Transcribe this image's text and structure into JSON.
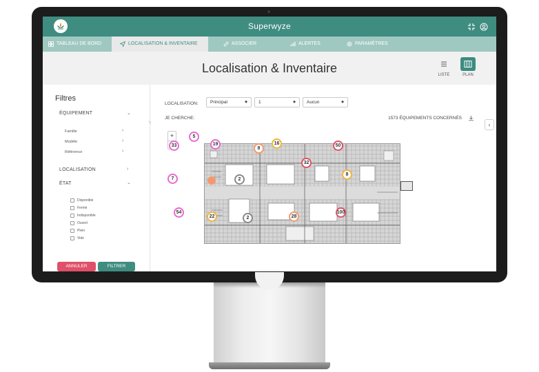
{
  "app": {
    "title": "Superwyze",
    "brand_color": "#3f8c80",
    "nav_color": "#9fc8c1"
  },
  "nav": [
    {
      "label": "TABLEAU DE BORD",
      "icon": "dashboard-grid-icon",
      "active": false
    },
    {
      "label": "LOCALISATION & INVENTAIRE",
      "icon": "location-arrow-icon",
      "active": true
    },
    {
      "label": "ASSOCIER",
      "icon": "link-icon",
      "active": false
    },
    {
      "label": "ALERTES",
      "icon": "signal-bars-icon",
      "active": false
    },
    {
      "label": "PARAMÈTRES",
      "icon": "gear-icon",
      "active": false
    }
  ],
  "page": {
    "title": "Localisation & Inventaire",
    "view_list_label": "LISTE",
    "view_plan_label": "PLAN",
    "active_view": "plan"
  },
  "filters": {
    "title": "Filtres",
    "equipment_label": "ÉQUIPEMENT",
    "equipment_items": [
      "Famille",
      "Modèle",
      "Référence"
    ],
    "location_label": "LOCALISATION",
    "state_label": "ÉTAT",
    "state_options": [
      "Disponible",
      "Fermé",
      "Indisponible",
      "Ouvert",
      "Plein",
      "Vide"
    ],
    "cancel_label": "ANNULER",
    "filter_label": "FILTRER",
    "cancel_color": "#e05068"
  },
  "toolbar": {
    "location_label": "LOCALISATION:",
    "select_site": "Principal",
    "select_floor": "1",
    "select_zone": "Aucun",
    "search_label": "JE CHERCHE:",
    "count_text": "1573 ÉQUIPEMENTS CONCERNÉS"
  },
  "zoom": {
    "in": "+",
    "out": "−"
  },
  "markers": [
    {
      "value": "5",
      "color": "#e86ad0"
    },
    {
      "value": "33",
      "color": "#e86ad0"
    },
    {
      "value": "19",
      "color": "#e86ad0"
    },
    {
      "value": "8",
      "color": "#f29a6e"
    },
    {
      "value": "16",
      "color": "#f0b43c"
    },
    {
      "value": "50",
      "color": "#e05068"
    },
    {
      "value": "32",
      "color": "#e05068"
    },
    {
      "value": "8",
      "color": "#f0b43c"
    },
    {
      "value": "7",
      "color": "#e86ad0"
    },
    {
      "value": "2",
      "color": "#888888"
    },
    {
      "value": "54",
      "color": "#e86ad0"
    },
    {
      "value": "22",
      "color": "#f0b43c"
    },
    {
      "value": "2",
      "color": "#888888"
    },
    {
      "value": "28",
      "color": "#f29a6e"
    },
    {
      "value": "100",
      "color": "#e05068"
    }
  ]
}
